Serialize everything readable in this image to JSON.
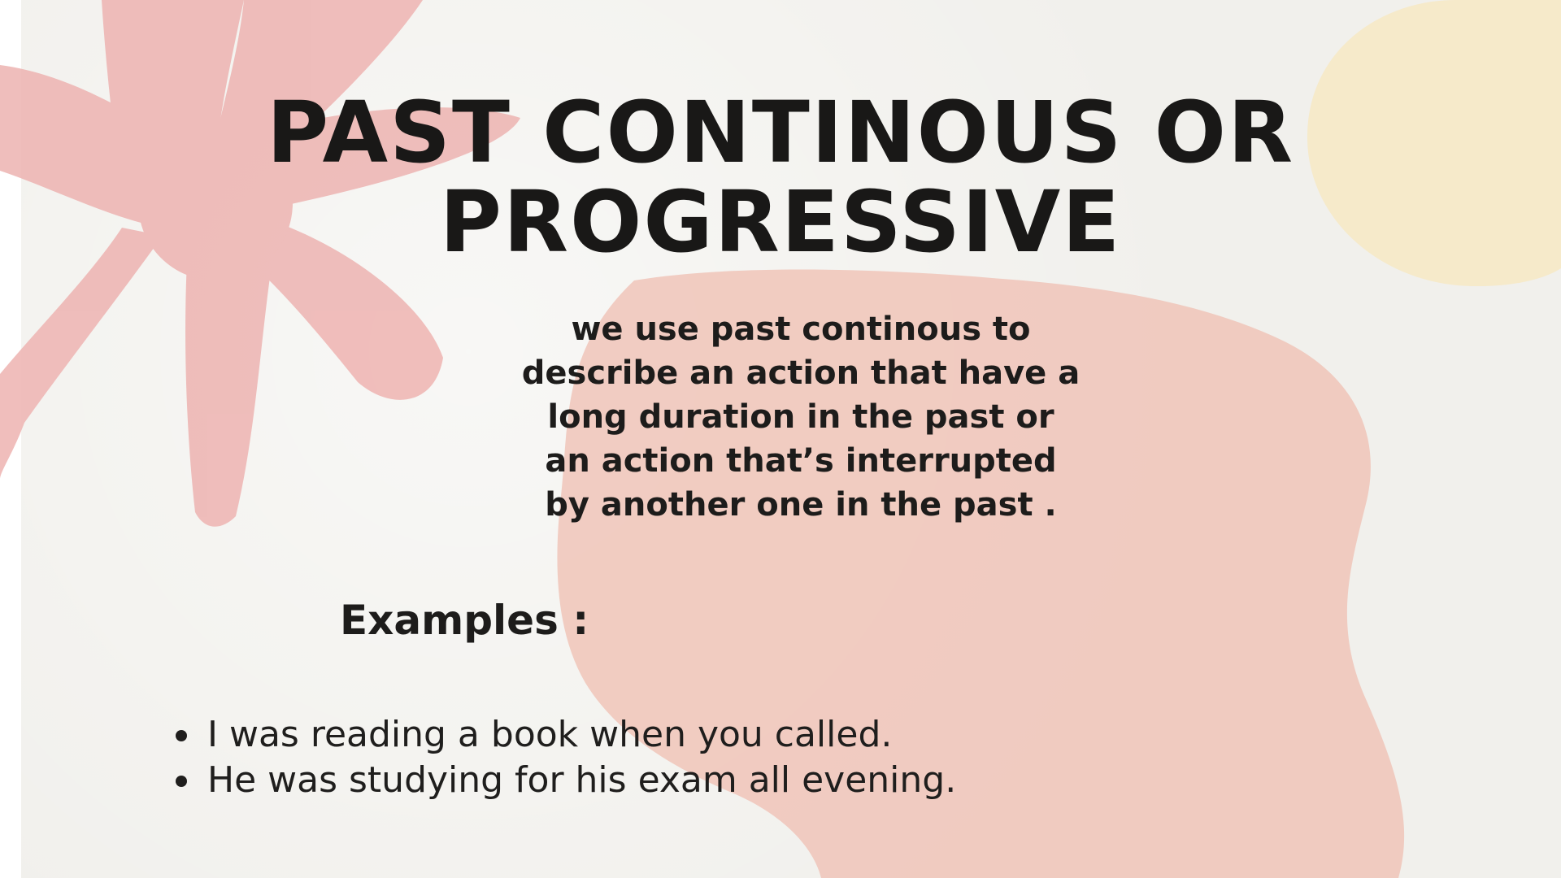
{
  "slide": {
    "title": "PAST CONTINOUS OR PROGRESSIVE",
    "description": "we use past continous to describe an action that have a long duration in the past or an action that’s interrupted by another one in the past .",
    "examples_heading": "Examples :",
    "examples": [
      "I was reading a book when you called.",
      "He was studying for his exam all evening."
    ]
  },
  "colors": {
    "background": "#f1f0ec",
    "flower_pink": "#eeb7b5",
    "blob_pink": "#f0c4b8",
    "circle_yellow": "#f6e9c6",
    "text": "#1d1c1b"
  },
  "icons": {
    "bullet": "filled-circle"
  }
}
